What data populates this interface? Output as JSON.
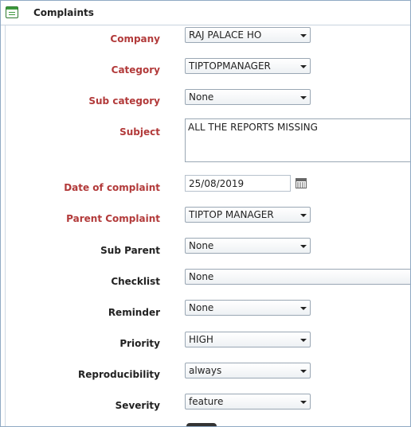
{
  "window": {
    "title": "Complaints"
  },
  "form": {
    "company": {
      "label": "Company",
      "value": "RAJ PALACE HO"
    },
    "category": {
      "label": "Category",
      "value": "TIPTOPMANAGER"
    },
    "sub_category": {
      "label": "Sub category",
      "value": "None"
    },
    "subject": {
      "label": "Subject",
      "value": "ALL THE REPORTS MISSING"
    },
    "date_of_complaint": {
      "label": "Date of complaint",
      "value": "25/08/2019"
    },
    "parent_complaint": {
      "label": "Parent Complaint",
      "value": "TIPTOP MANAGER"
    },
    "sub_parent": {
      "label": "Sub Parent",
      "value": "None"
    },
    "checklist": {
      "label": "Checklist",
      "value": "None"
    },
    "reminder": {
      "label": "Reminder",
      "value": "None"
    },
    "priority": {
      "label": "Priority",
      "value": "HIGH"
    },
    "reproducibility": {
      "label": "Reproducibility",
      "value": "always"
    },
    "severity": {
      "label": "Severity",
      "value": "feature"
    }
  },
  "colors": {
    "required_label": "#b23a3a",
    "optional_label": "#222222",
    "border": "#9aa7b4"
  },
  "icons": {
    "title": "form-icon",
    "date_picker": "calendar-icon",
    "dropdown": "chevron-down-icon"
  }
}
